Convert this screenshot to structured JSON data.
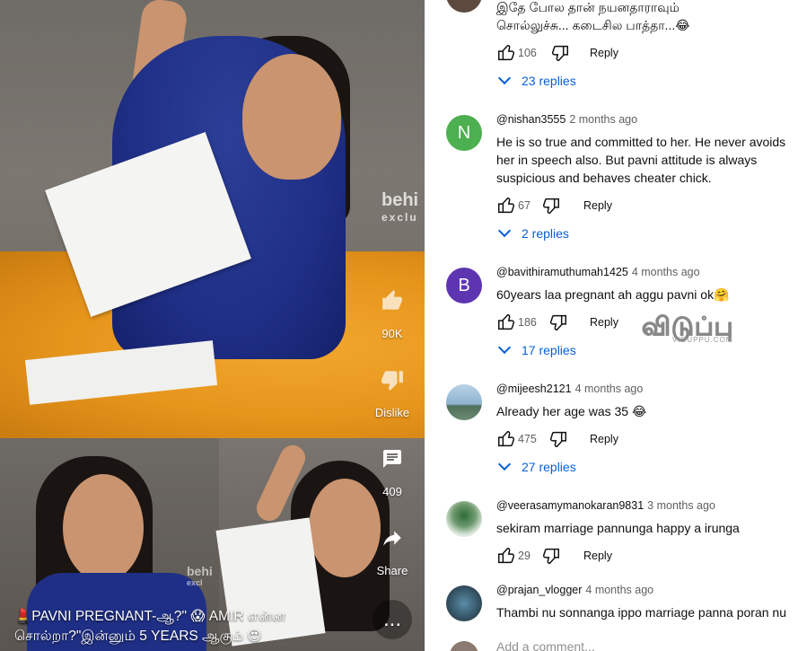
{
  "video": {
    "watermark_brand": "behi",
    "watermark_sub": "exclu",
    "watermark_small": "behi",
    "watermark_small_sub": "excl",
    "like_count": "90K",
    "dislike_label": "Dislike",
    "comments_count": "409",
    "share_label": "Share",
    "more_label": "...",
    "caption_line1": "💄PAVNI PREGNANT-ஆ?\" 😱 AMIR என்ன",
    "caption_line2": "சொல்றா?\"இன்னும் 5 YEARS ஆகும் 😍"
  },
  "colors": {
    "link_blue": "#065fd4",
    "progress_red": "#e62117",
    "sofa": "#e6951b",
    "shirt": "#1f2f86"
  },
  "comments": [
    {
      "author": "",
      "time": "",
      "text_line1": "இதே போல தான் நயனதாராவும்",
      "text_line2": "சொல்லுச்சு... கடைசில பாத்தா...😂",
      "likes": "106",
      "reply_label": "Reply",
      "replies_label": "23 replies"
    },
    {
      "author": "@nishan3555",
      "time": "2 months ago",
      "avatar_letter": "N",
      "avatar_color": "#43a047",
      "text_line1": "He is so true and committed to her. He never avoids",
      "text_line2": "her in speech also. But pavni attitude is always",
      "text_line3": "suspicious and behaves cheater chick.",
      "likes": "67",
      "reply_label": "Reply",
      "replies_label": "2 replies"
    },
    {
      "author": "@bavithiramuthumah1425",
      "time": "4 months ago",
      "avatar_letter": "B",
      "avatar_color": "#512da8",
      "text_line1": "60years laa pregnant ah aggu pavni ok🤗",
      "likes": "186",
      "reply_label": "Reply",
      "replies_label": "17 replies"
    },
    {
      "author": "@mijeesh2121",
      "time": "4 months ago",
      "text_line1": "Already her age was 35 😂",
      "likes": "475",
      "reply_label": "Reply",
      "replies_label": "27 replies"
    },
    {
      "author": "@veerasamymanokaran9831",
      "time": "3 months ago",
      "text_line1": "sekiram marriage  pannunga happy a irunga",
      "likes": "29",
      "reply_label": "Reply"
    },
    {
      "author": "@prajan_vlogger",
      "time": "4 months ago",
      "text_line1": "Thambi nu sonnanga ippo marriage panna poran nu"
    }
  ],
  "overlay_logo": "விடுப்பு",
  "overlay_logo_sub": "VIDUPPU.COM",
  "add_comment_placeholder": "Add a comment..."
}
